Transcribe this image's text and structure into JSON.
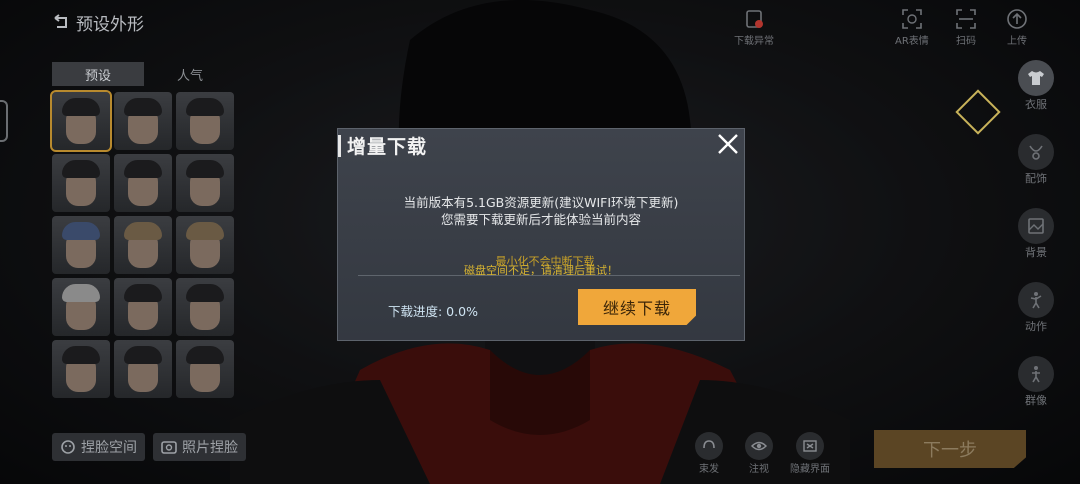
{
  "header": {
    "back_label": "预设外形"
  },
  "tabs": [
    {
      "label": "预设"
    },
    {
      "label": "人气"
    }
  ],
  "top_icons": [
    {
      "label": "下载异常",
      "icon": "download-error-icon"
    },
    {
      "label": "AR表情",
      "icon": "ar-face-icon"
    },
    {
      "label": "扫码",
      "icon": "scan-icon"
    },
    {
      "label": "上传",
      "icon": "upload-icon"
    }
  ],
  "right_menu": [
    {
      "label": "衣服",
      "icon": "clothes-icon"
    },
    {
      "label": "配饰",
      "icon": "accessory-icon"
    },
    {
      "label": "背景",
      "icon": "background-icon"
    },
    {
      "label": "动作",
      "icon": "pose-icon"
    },
    {
      "label": "群像",
      "icon": "group-icon"
    }
  ],
  "bottom_left": [
    {
      "label": "捏脸空间",
      "icon": "face-space-icon"
    },
    {
      "label": "照片捏脸",
      "icon": "photo-face-icon"
    }
  ],
  "bottom_mid": [
    {
      "label": "束发",
      "icon": "hair-icon"
    },
    {
      "label": "注视",
      "icon": "eye-icon"
    },
    {
      "label": "隐藏界面",
      "icon": "hide-ui-icon"
    }
  ],
  "next_button": {
    "label": "下一步"
  },
  "dialog": {
    "title": "增量下载",
    "message_line1": "当前版本有5.1GB资源更新(建议WIFI环境下更新)",
    "message_line2": "您需要下载更新后才能体验当前内容",
    "warning_under": "最小化不会中断下载",
    "warning_over": "磁盘空间不足，请清理后重试！",
    "progress_label": "下载进度: 0.0%",
    "continue_label": "继续下载"
  },
  "colors": {
    "accent": "#f0a73a",
    "warning": "#d9b531",
    "dialog_bg": "#3a3f48"
  }
}
